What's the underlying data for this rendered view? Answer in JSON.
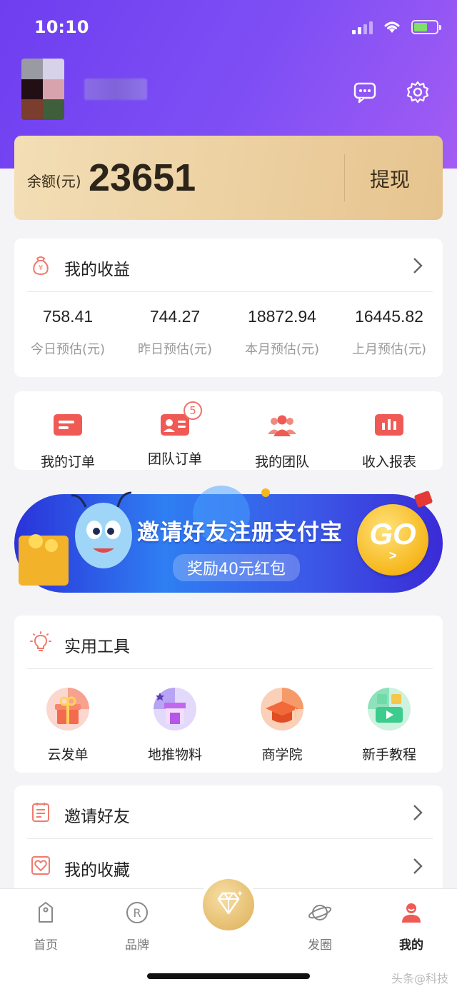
{
  "status": {
    "time": "10:10"
  },
  "balance": {
    "label": "余额(元)",
    "value": "23651",
    "withdraw": "提现"
  },
  "earnings": {
    "title": "我的收益",
    "stats": [
      {
        "value": "758.41",
        "label": "今日预估(元)"
      },
      {
        "value": "744.27",
        "label": "昨日预估(元)"
      },
      {
        "value": "18872.94",
        "label": "本月预估(元)"
      },
      {
        "value": "16445.82",
        "label": "上月预估(元)"
      }
    ]
  },
  "orders": {
    "items": [
      {
        "label": "我的订单"
      },
      {
        "label": "团队订单",
        "badge": "5"
      },
      {
        "label": "我的团队"
      },
      {
        "label": "收入报表"
      }
    ]
  },
  "banner": {
    "title": "邀请好友注册支付宝",
    "subtitle": "奖励40元红包",
    "cta": "GO",
    "cta_arrow": ">"
  },
  "tools": {
    "title": "实用工具",
    "items": [
      {
        "label": "云发单"
      },
      {
        "label": "地推物料"
      },
      {
        "label": "商学院"
      },
      {
        "label": "新手教程"
      }
    ]
  },
  "list": {
    "items": [
      {
        "label": "邀请好友"
      },
      {
        "label": "我的收藏"
      }
    ]
  },
  "tabbar": {
    "items": [
      {
        "label": "首页"
      },
      {
        "label": "品牌"
      },
      {
        "label": "发圈"
      },
      {
        "label": "我的"
      }
    ]
  },
  "watermark": "头条@科技"
}
